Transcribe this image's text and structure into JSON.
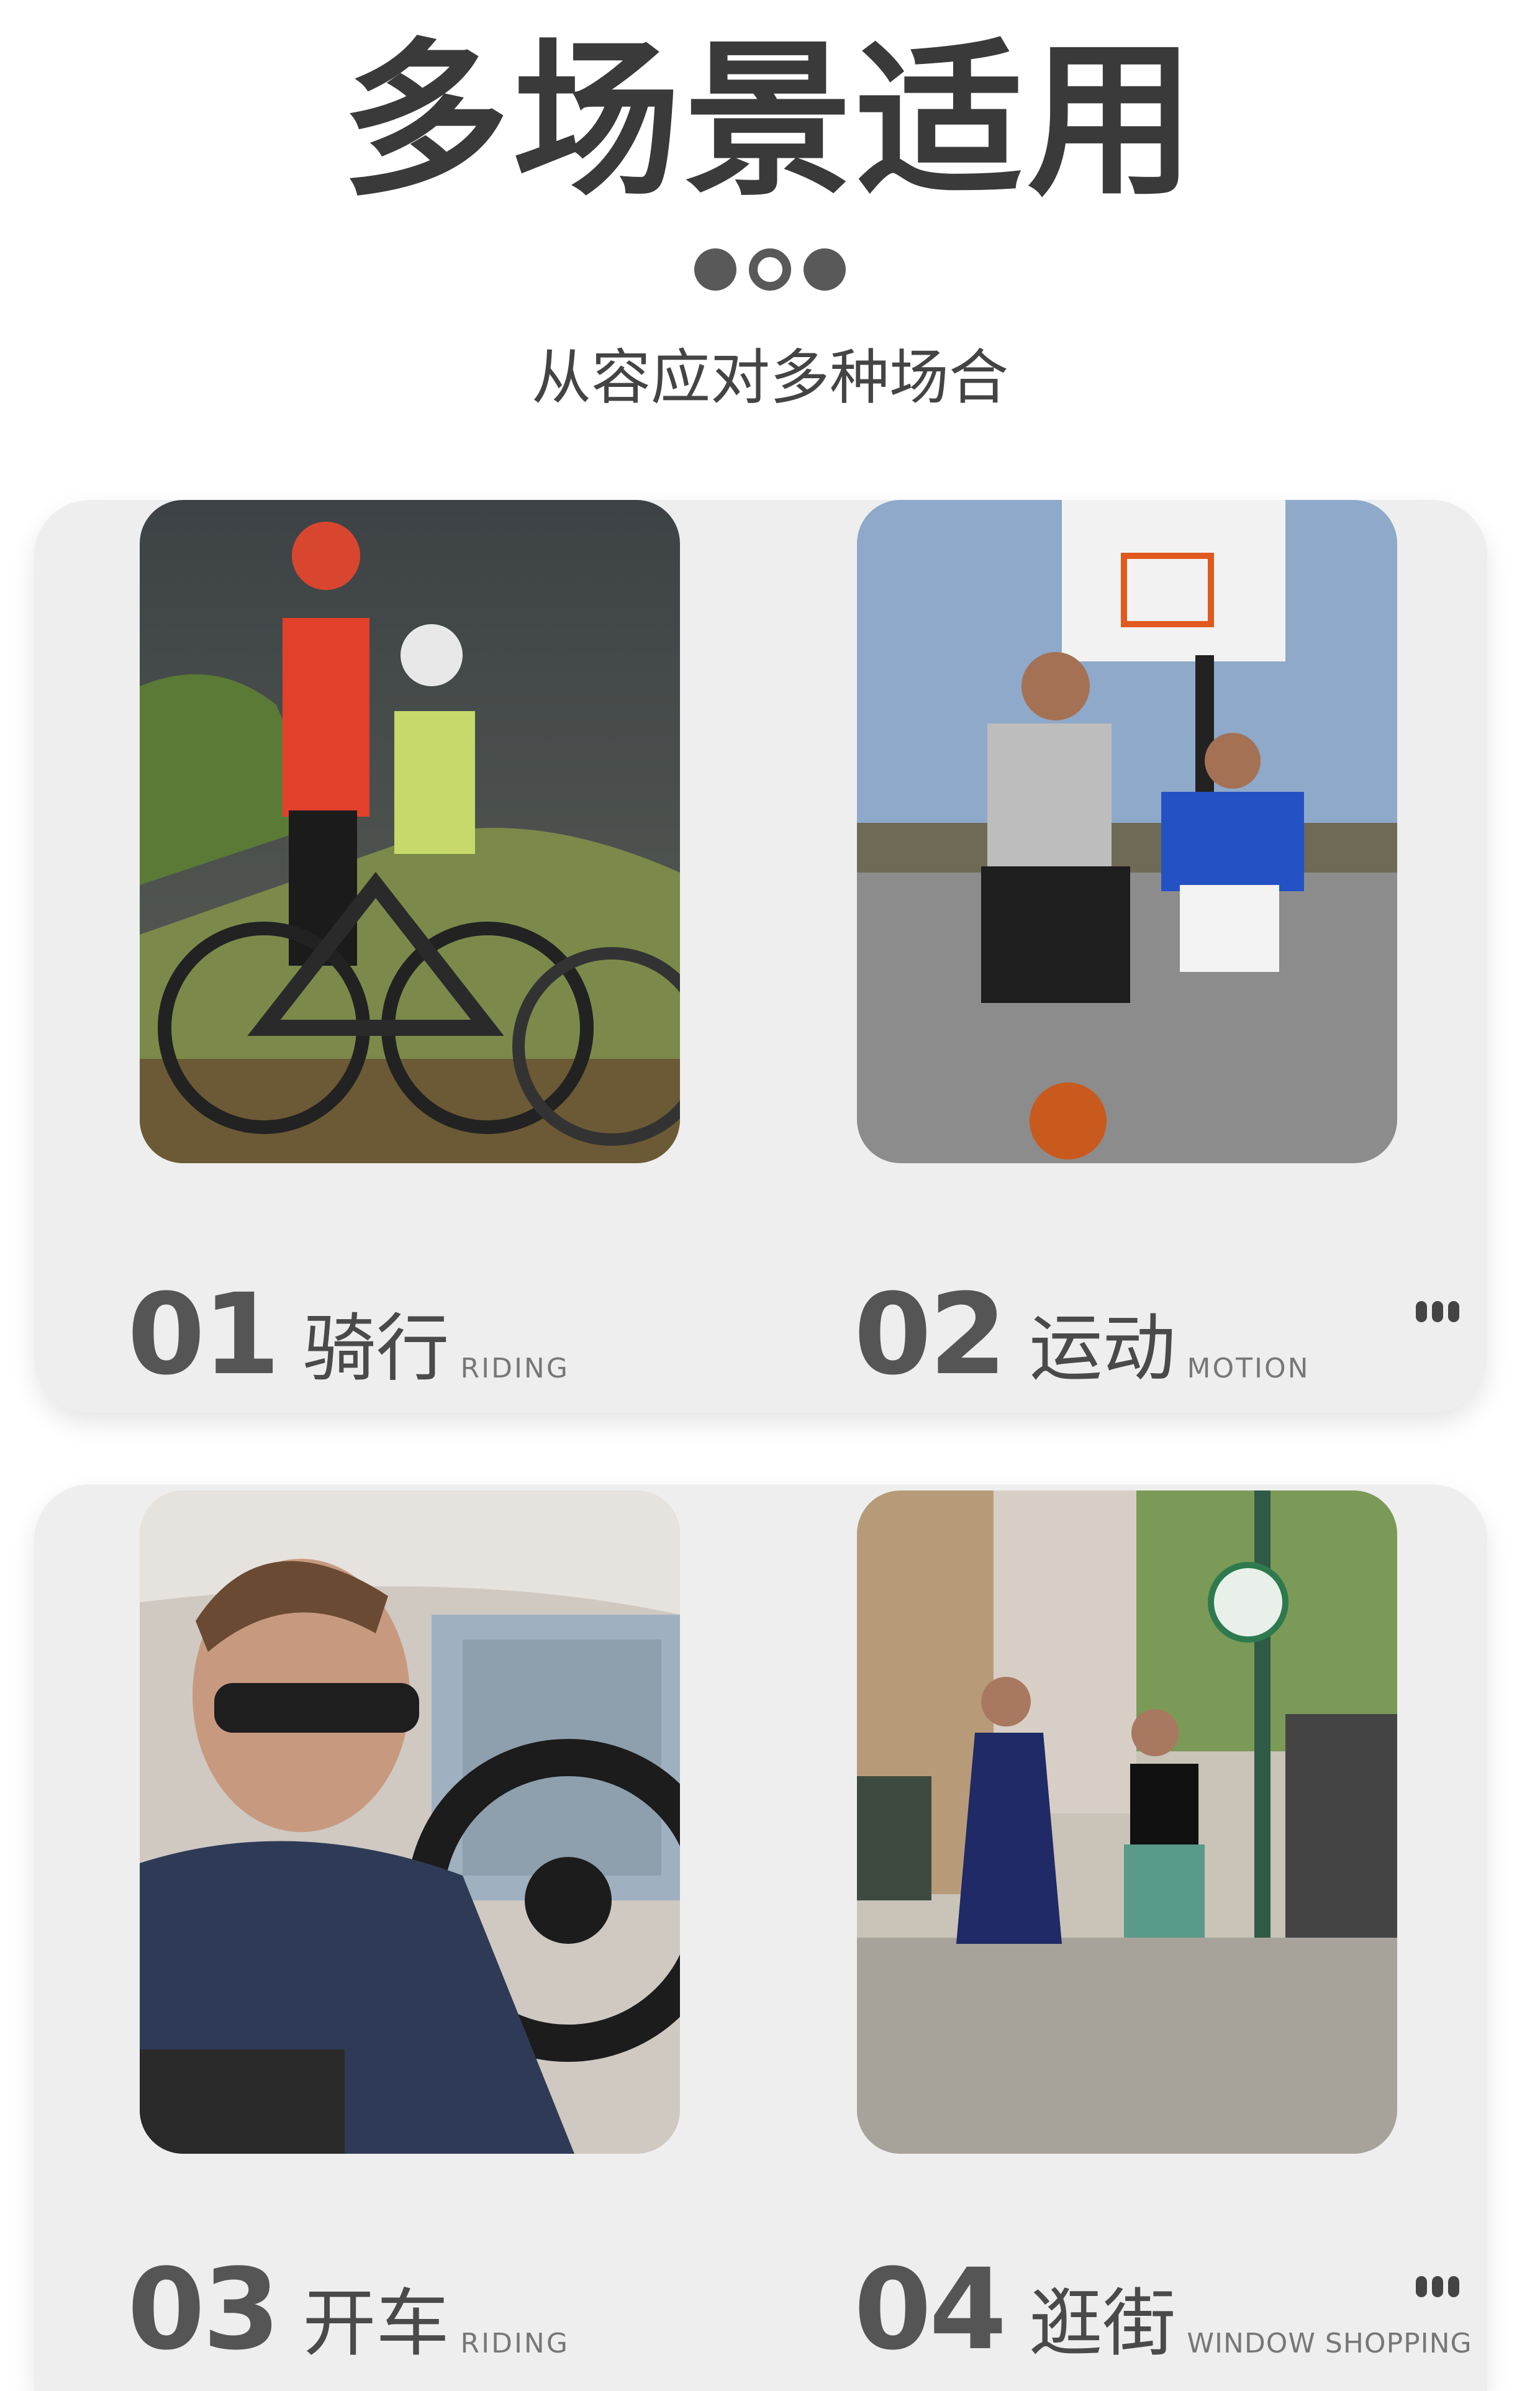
{
  "header": {
    "title": "多场景适用",
    "subtitle": "从容应对多种场合"
  },
  "scenes": [
    {
      "number": "01",
      "label_cn": "骑行",
      "label_en": "RIDING",
      "image": "cycling-photo"
    },
    {
      "number": "02",
      "label_cn": "运动",
      "label_en": "MOTION",
      "image": "basketball-photo"
    },
    {
      "number": "03",
      "label_cn": "开车",
      "label_en": "RIDING",
      "image": "driving-photo"
    },
    {
      "number": "04",
      "label_cn": "逛街",
      "label_en": "WINDOW SHOPPING",
      "image": "shopping-photo"
    }
  ],
  "colors": {
    "card_bg": "#eeeeee",
    "title_text": "#3a3a3a",
    "dot": "#595959"
  },
  "icons": [
    "more-icon"
  ]
}
